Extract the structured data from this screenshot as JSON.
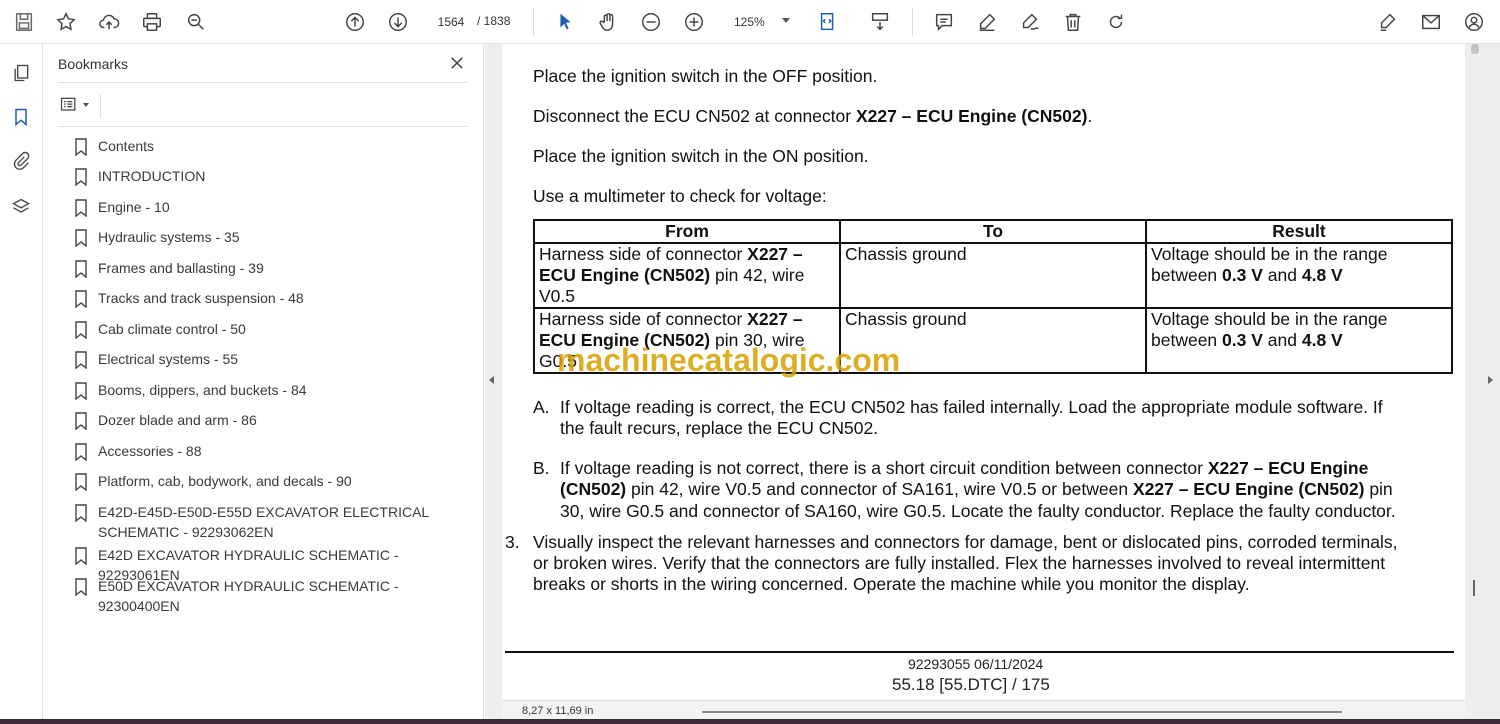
{
  "toolbar": {
    "current_page": "1564",
    "total_pages": "/ 1838",
    "zoom": "125%"
  },
  "bookmarks": {
    "title": "Bookmarks",
    "items": [
      {
        "label": "Contents"
      },
      {
        "label": "INTRODUCTION"
      },
      {
        "label": "Engine - 10"
      },
      {
        "label": "Hydraulic systems - 35"
      },
      {
        "label": "Frames and ballasting - 39"
      },
      {
        "label": "Tracks and track suspension - 48"
      },
      {
        "label": "Cab climate control - 50"
      },
      {
        "label": "Electrical systems - 55"
      },
      {
        "label": "Booms, dippers, and buckets - 84"
      },
      {
        "label": "Dozer blade and arm - 86"
      },
      {
        "label": "Accessories - 88"
      },
      {
        "label": "Platform, cab, bodywork, and decals - 90"
      },
      {
        "label": "E42D-E45D-E50D-E55D EXCAVATOR ELECTRICAL",
        "label2": "SCHEMATIC - 92293062EN"
      },
      {
        "label": "E42D EXCAVATOR HYDRAULIC SCHEMATIC - 92293061EN"
      },
      {
        "label": "E50D EXCAVATOR HYDRAULIC SCHEMATIC - 92300400EN"
      }
    ]
  },
  "document": {
    "line1": "Place the ignition switch in the OFF position.",
    "line2_pre": "Disconnect the ECU CN502 at connector ",
    "line2_bold": "X227 – ECU Engine (CN502)",
    "line2_post": ".",
    "line3": "Place the ignition switch in the ON position.",
    "line4": "Use a multimeter to check for voltage:",
    "table": {
      "headers": [
        "From",
        "To",
        "Result"
      ],
      "row1": {
        "from_a": "Harness side of connector ",
        "from_b": "X227 –",
        "from_c": "ECU Engine (CN502)",
        "from_d": " pin 42, wire",
        "from_e": "V0.5",
        "to": "Chassis ground",
        "res_a": "Voltage should be in the range",
        "res_b": "between ",
        "res_c": "0.3 V",
        "res_d": " and ",
        "res_e": "4.8 V"
      },
      "row2": {
        "from_a": "Harness side of connector ",
        "from_b": "X227 –",
        "from_c": "ECU Engine (CN502)",
        "from_d": " pin 30, wire",
        "from_e": "G0.5",
        "to": "Chassis ground",
        "res_a": "Voltage should be in the range",
        "res_b": "between ",
        "res_c": "0.3 V",
        "res_d": " and ",
        "res_e": "4.8 V"
      }
    },
    "watermark": "machinecatalogic.com",
    "itemA_marker": "A.",
    "itemA_l1": "If voltage reading is correct, the ECU CN502 has failed internally.  Load the appropriate module software.  If",
    "itemA_l2": "the fault recurs, replace the ECU CN502.",
    "itemB_marker": "B.",
    "itemB_l1a": "If voltage reading is not correct, there is a short circuit condition between connector ",
    "itemB_l1b": "X227 – ECU Engine",
    "itemB_l2a": "(CN502)",
    "itemB_l2b": " pin 42, wire V0.5 and connector of SA161, wire V0.5 or between ",
    "itemB_l2c": "X227 – ECU Engine (CN502)",
    "itemB_l2d": " pin",
    "itemB_l3": "30, wire G0.5 and connector of SA160, wire G0.5. Locate the faulty conductor. Replace the faulty conductor.",
    "item3_marker": "3.",
    "item3_l1": "Visually inspect the relevant harnesses and connectors for damage, bent or dislocated pins, corroded terminals,",
    "item3_l2": "or broken wires.  Verify that the connectors are fully installed.  Flex the harnesses involved to reveal intermittent",
    "item3_l3": "breaks or shorts in the wiring concerned.  Operate the machine while you monitor the display.",
    "footer_doc": "92293055 06/11/2024",
    "footer_page": "55.18 [55.DTC] / 175"
  },
  "status": {
    "page_size": "8,27 x 11,69 in"
  }
}
